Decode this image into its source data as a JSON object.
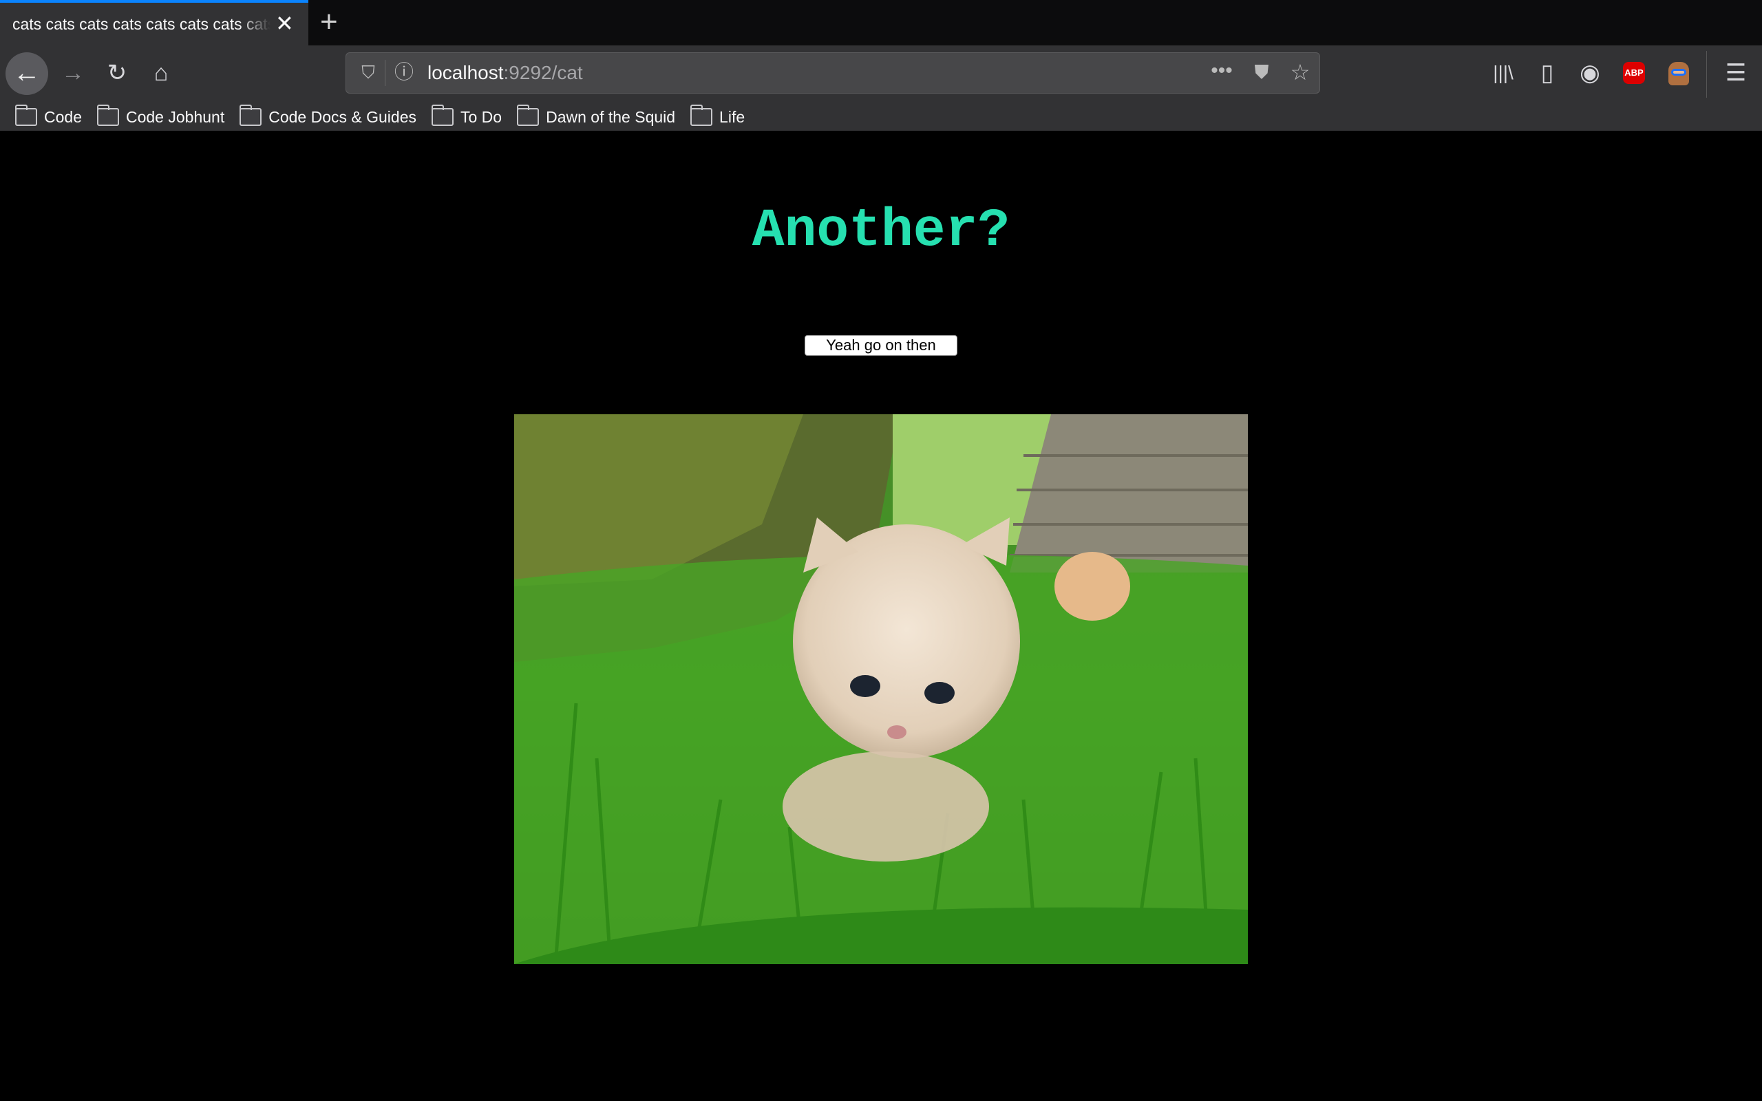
{
  "browser": {
    "tab_title": "cats cats cats cats cats cats cats cats",
    "url_host": "localhost",
    "url_rest": ":9292/cat",
    "bookmarks": [
      {
        "label": "Code"
      },
      {
        "label": "Code Jobhunt"
      },
      {
        "label": "Code Docs & Guides"
      },
      {
        "label": "To Do"
      },
      {
        "label": "Dawn of the Squid"
      },
      {
        "label": "Life"
      }
    ],
    "extension_abp_label": "ABP",
    "accent_color": "#0a84ff"
  },
  "page": {
    "heading": "Another?",
    "heading_color": "#26e0b0",
    "button_label": "Yeah go on then",
    "image_subject": "kitten-in-grass-photo"
  }
}
